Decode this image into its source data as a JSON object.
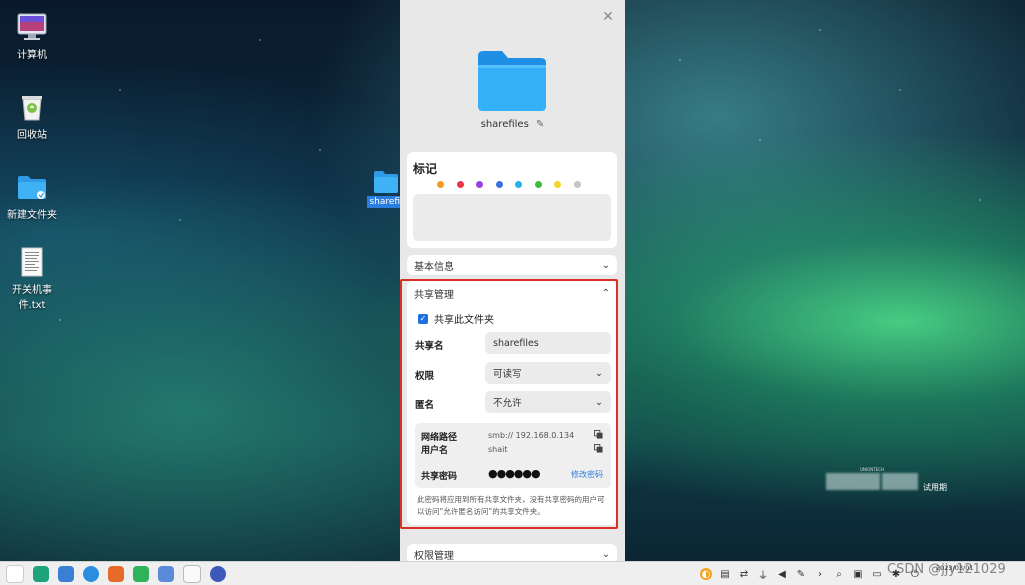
{
  "desktop": {
    "icons": [
      {
        "label": "计算机",
        "icon": "computer-icon"
      },
      {
        "label": "回收站",
        "icon": "trash-icon"
      },
      {
        "label": "新建文件夹",
        "icon": "folder-icon"
      },
      {
        "label": "开关机事件.txt",
        "icon": "text-file-icon"
      }
    ],
    "selected_item": {
      "label": "sharefil",
      "icon": "folder-icon"
    },
    "trial_text": "试用期",
    "blurred_caption": "UNIONTECH"
  },
  "panel": {
    "close_icon": "close-icon",
    "folder_name": "sharefiles",
    "tag_section": {
      "title": "标记",
      "colors": [
        "#f59a23",
        "#e8354a",
        "#9b3fe0",
        "#3b6fe6",
        "#21b2e8",
        "#3fbd3a",
        "#f0d52b",
        "#c4c4c4"
      ]
    },
    "basic_info": {
      "title": "基本信息"
    },
    "share": {
      "title": "共享管理",
      "checkbox_label": "共享此文件夹",
      "share_name_label": "共享名",
      "share_name_value": "sharefiles",
      "permission_label": "权限",
      "permission_value": "可读写",
      "anonymous_label": "匿名",
      "anonymous_value": "不允许",
      "network_path_label": "网络路径",
      "network_path_value": "smb:// 192.168.0.134",
      "username_label": "用户名",
      "username_value": "shait",
      "password_label": "共享密码",
      "password_value": "●●●●●●",
      "change_password": "修改密码",
      "note": "此密码将应用到所有共享文件夹，没有共享密码的用户可以访问“允许匿名访问”的共享文件夹。"
    },
    "permission_section": {
      "title": "权限管理"
    }
  },
  "taskbar": {
    "watermark": "CSDN @jjy121029",
    "date": "2023/03/01"
  }
}
